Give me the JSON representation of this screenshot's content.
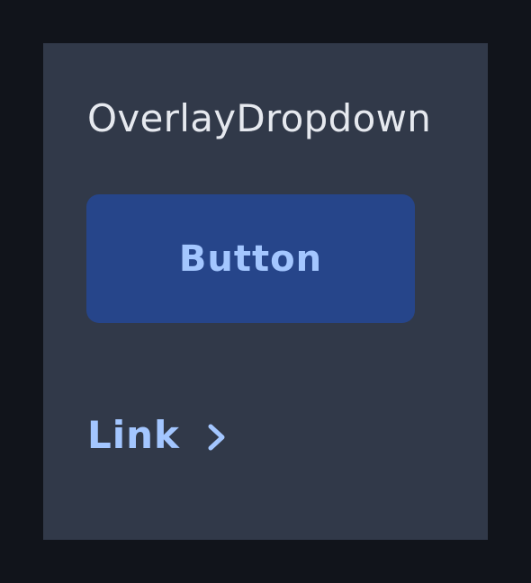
{
  "card": {
    "title": "OverlayDropdown",
    "button_label": "Button",
    "link_label": "Link",
    "link_icon": "chevron-right-icon"
  },
  "colors": {
    "page_background": "#11141b",
    "card_background": "#313949",
    "title_text": "#e6e9ef",
    "button_background": "#26458a",
    "accent_text": "#a3c6ff"
  }
}
